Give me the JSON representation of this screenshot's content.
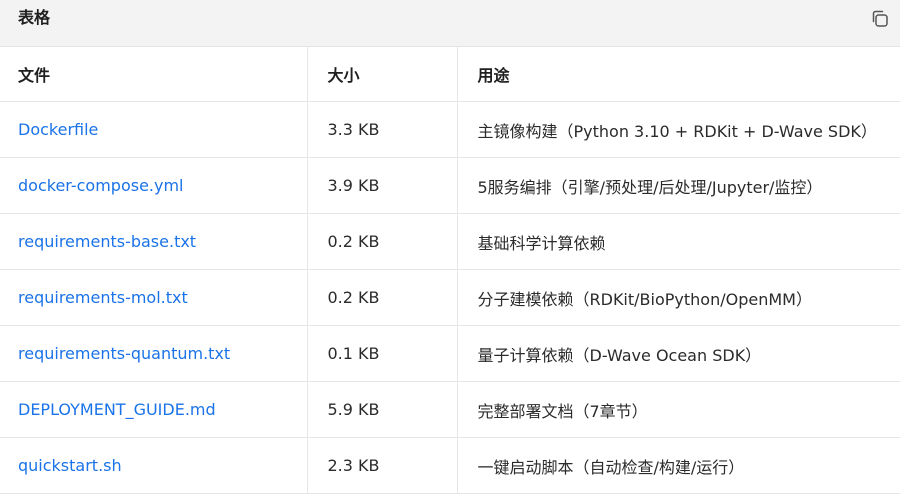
{
  "card": {
    "title": "表格"
  },
  "icons": {
    "copy": "copy-icon"
  },
  "table": {
    "headers": [
      "文件",
      "大小",
      "用途"
    ],
    "rows": [
      {
        "file": "Dockerfile",
        "size": "3.3 KB",
        "purpose": "主镜像构建（Python 3.10 + RDKit + D-Wave SDK）"
      },
      {
        "file": "docker-compose.yml",
        "size": "3.9 KB",
        "purpose": "5服务编排（引擎/预处理/后处理/Jupyter/监控）"
      },
      {
        "file": "requirements-base.txt",
        "size": "0.2 KB",
        "purpose": "基础科学计算依赖"
      },
      {
        "file": "requirements-mol.txt",
        "size": "0.2 KB",
        "purpose": "分子建模依赖（RDKit/BioPython/OpenMM）"
      },
      {
        "file": "requirements-quantum.txt",
        "size": "0.1 KB",
        "purpose": "量子计算依赖（D-Wave Ocean SDK）"
      },
      {
        "file": "DEPLOYMENT_GUIDE.md",
        "size": "5.9 KB",
        "purpose": "完整部署文档（7章节）"
      },
      {
        "file": "quickstart.sh",
        "size": "2.3 KB",
        "purpose": "一键启动脚本（自动检查/构建/运行）"
      }
    ]
  },
  "colors": {
    "link": "#1a73e8",
    "header_bg": "#f3f3f3",
    "border": "#e6e6e6"
  }
}
